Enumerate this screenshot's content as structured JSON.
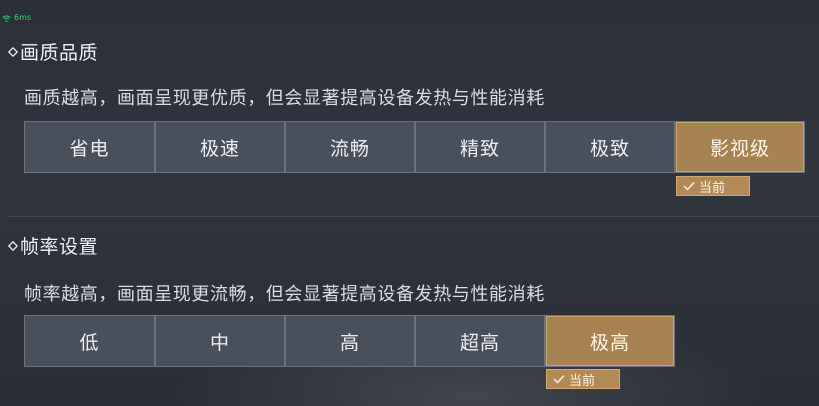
{
  "status": {
    "ping": "6ms",
    "icon": "wifi-icon",
    "color": "#39d17a"
  },
  "quality": {
    "title": "画质品质",
    "description": "画质越高，画面呈现更优质，但会显著提高设备发热与性能消耗",
    "options": [
      "省电",
      "极速",
      "流畅",
      "精致",
      "极致",
      "影视级"
    ],
    "selected": "影视级",
    "current_label": "当前"
  },
  "framerate": {
    "title": "帧率设置",
    "description": "帧率越高，画面呈现更流畅，但会显著提高设备发热与性能消耗",
    "options": [
      "低",
      "中",
      "高",
      "超高",
      "极高"
    ],
    "selected": "极高",
    "current_label": "当前"
  },
  "colors": {
    "accent": "#a78354",
    "option_bg": "#49505c",
    "background": "#2f343d"
  }
}
